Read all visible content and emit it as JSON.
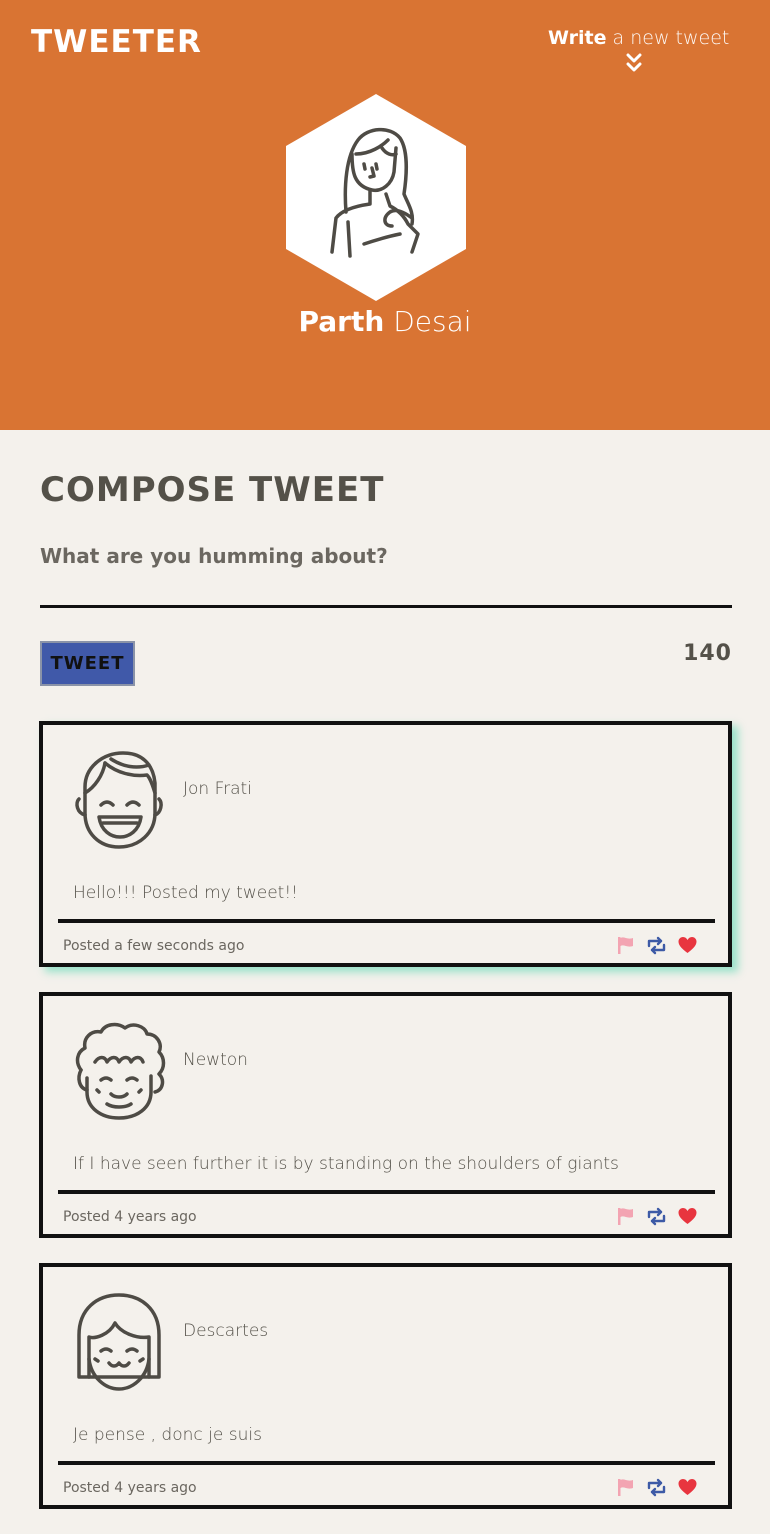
{
  "header": {
    "logo": "TWEETER",
    "compose_toggle": {
      "bold": "Write",
      "light": "a new tweet"
    },
    "profile": {
      "first_name": "Parth",
      "last_name": "Desai"
    },
    "bg_color": "#d97433"
  },
  "compose": {
    "title": "COMPOSE TWEET",
    "placeholder": "What are you humming about?",
    "button_label": "TWEET",
    "counter": "140",
    "button_color": "#4059a9"
  },
  "tweets": [
    {
      "name": "Jon Frati",
      "content": "Hello!!! Posted my tweet!!",
      "posted": "Posted a few seconds ago",
      "avatar": "smiling-boy-icon"
    },
    {
      "name": "Newton",
      "content": "If I have seen further it is by standing on the shoulders of giants",
      "posted": "Posted 4 years ago",
      "avatar": "curly-hair-icon"
    },
    {
      "name": "Descartes",
      "content": "Je pense , donc je suis",
      "posted": "Posted 4 years ago",
      "avatar": "bob-hair-icon"
    }
  ],
  "icons": {
    "flag": "flag-icon",
    "retweet": "retweet-icon",
    "like": "heart-icon"
  },
  "colors": {
    "flag": "#f3a4b2",
    "retweet": "#3d5aa6",
    "heart": "#e8353f"
  }
}
